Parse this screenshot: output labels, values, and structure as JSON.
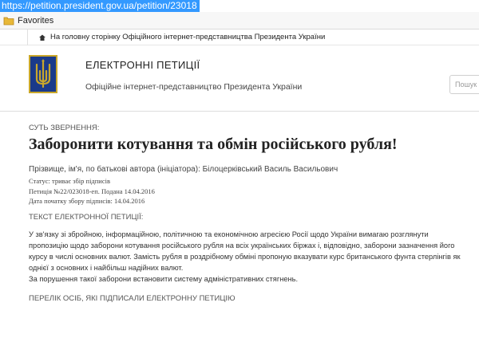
{
  "browser": {
    "url": "https://petition.president.gov.ua/petition/23018",
    "favorites_label": "Favorites"
  },
  "top_strip": {
    "home_link": "На головну сторінку Офіційного інтернет-представництва Президента України"
  },
  "header": {
    "title": "ЕЛЕКТРОННІ ПЕТИЦІЇ",
    "subtitle": "Офіційне інтернет-представництво Президента України",
    "search_placeholder": "Пошук е"
  },
  "petition": {
    "essence_label": "СУТЬ ЗВЕРНЕННЯ:",
    "title": "Заборонити котування та обмін російського рубля!",
    "author_line": "Прізвище, ім'я, по батькові автора (ініціатора): Білоцерківський Василь Васильович",
    "status": "Статус: триває збір підписів",
    "number": "Петиція №22/023018-еп. Подана 14.04.2016",
    "start_date": "Дата початку збору підписів: 14.04.2016",
    "text_label": "ТЕКСТ ЕЛЕКТРОННОЇ ПЕТИЦІЇ:",
    "text_paragraph_1": "У зв'язку зі збройною, інформаційною, політичною та економічною агресією Росії щодо України вимагаю розглянути пропозицію щодо заборони котування російського рубля на всіх українських біржах і, відповідно, заборони зазначення його курсу в числі основних валют. Замість рубля в роздрібному обміні пропоную вказувати курс британського фунта стерлінгів як однієї з основних і найбільш надійних валют.",
    "text_paragraph_2": "За порушення такої заборони встановити систему адміністративних стягнень.",
    "signers_label": "ПЕРЕЛІК ОСІБ, ЯКІ ПІДПИСАЛИ ЕЛЕКТРОННУ ПЕТИЦІЮ"
  },
  "colors": {
    "url_highlight": "#3399ff",
    "emblem_blue": "#1a3a8a",
    "emblem_gold": "#c9a72b"
  }
}
